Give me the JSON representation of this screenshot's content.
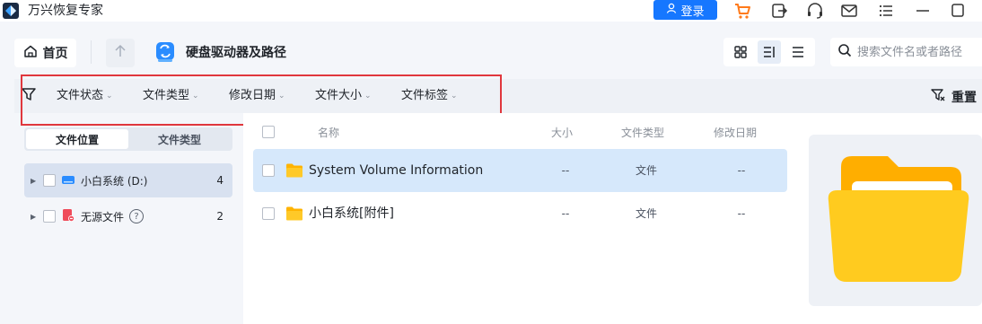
{
  "app": {
    "title": "万兴恢复专家",
    "login_label": "登录",
    "icons": [
      "cart-icon",
      "export-icon",
      "headset-icon",
      "mail-icon",
      "menu-icon",
      "minimize-icon",
      "maximize-icon"
    ]
  },
  "toolbar": {
    "home_label": "首页",
    "location_title": "硬盘驱动器及路径",
    "search": {
      "placeholder": "搜索文件名或者路径",
      "value": ""
    }
  },
  "filters": {
    "items": [
      "文件状态",
      "文件类型",
      "修改日期",
      "文件大小",
      "文件标签"
    ],
    "reset_label": "重置"
  },
  "left_panel": {
    "tabs": [
      "文件位置",
      "文件类型"
    ],
    "active_tab": "文件位置",
    "tree": [
      {
        "label": "小白系统 (D:)",
        "count": "4",
        "icon": "drive-icon",
        "selected": true
      },
      {
        "label": "无源文件",
        "count": "2",
        "icon": "lost-file-icon",
        "help": "?"
      }
    ]
  },
  "file_list": {
    "columns": {
      "name": "名称",
      "size": "大小",
      "type": "文件类型",
      "modified": "修改日期"
    },
    "rows": [
      {
        "name": "System Volume Information",
        "size": "--",
        "type": "文件",
        "modified": "--",
        "selected": true
      },
      {
        "name": "小白系统[附件]",
        "size": "--",
        "type": "文件",
        "modified": "--",
        "selected": false
      }
    ]
  },
  "colors": {
    "accent": "#1677ff",
    "highlight_box": "#e0373d",
    "folder": "#ffb300",
    "selected_row": "#d6e8fb"
  }
}
